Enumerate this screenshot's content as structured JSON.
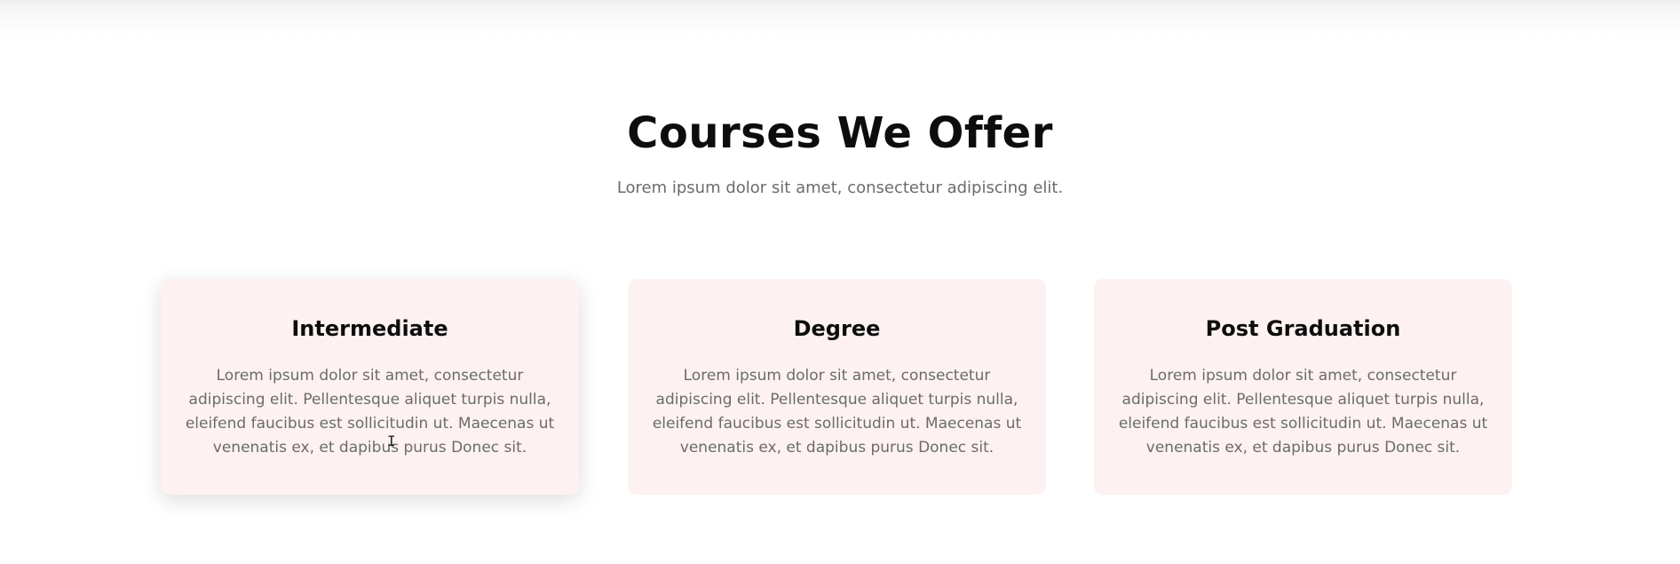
{
  "section": {
    "title": "Courses We Offer",
    "subtitle": "Lorem ipsum dolor sit amet, consectetur adipiscing elit."
  },
  "cards": [
    {
      "title": "Intermediate",
      "text": "Lorem ipsum dolor sit amet, consectetur adipiscing elit. Pellentesque aliquet turpis nulla, eleifend faucibus est sollicitudin ut. Maecenas ut venenatis ex, et dapibus purus Donec sit."
    },
    {
      "title": "Degree",
      "text": "Lorem ipsum dolor sit amet, consectetur adipiscing elit. Pellentesque aliquet turpis nulla, eleifend faucibus est sollicitudin ut. Maecenas ut venenatis ex, et dapibus purus Donec sit."
    },
    {
      "title": "Post Graduation",
      "text": "Lorem ipsum dolor sit amet, consectetur adipiscing elit. Pellentesque aliquet turpis nulla, eleifend faucibus est sollicitudin ut. Maecenas ut venenatis ex, et dapibus purus Donec sit."
    }
  ],
  "colors": {
    "card_background": "#fdf2f1",
    "heading": "#0d0d0d",
    "body_text": "#6b6b6b"
  },
  "cursor_icon": "text-cursor-icon"
}
